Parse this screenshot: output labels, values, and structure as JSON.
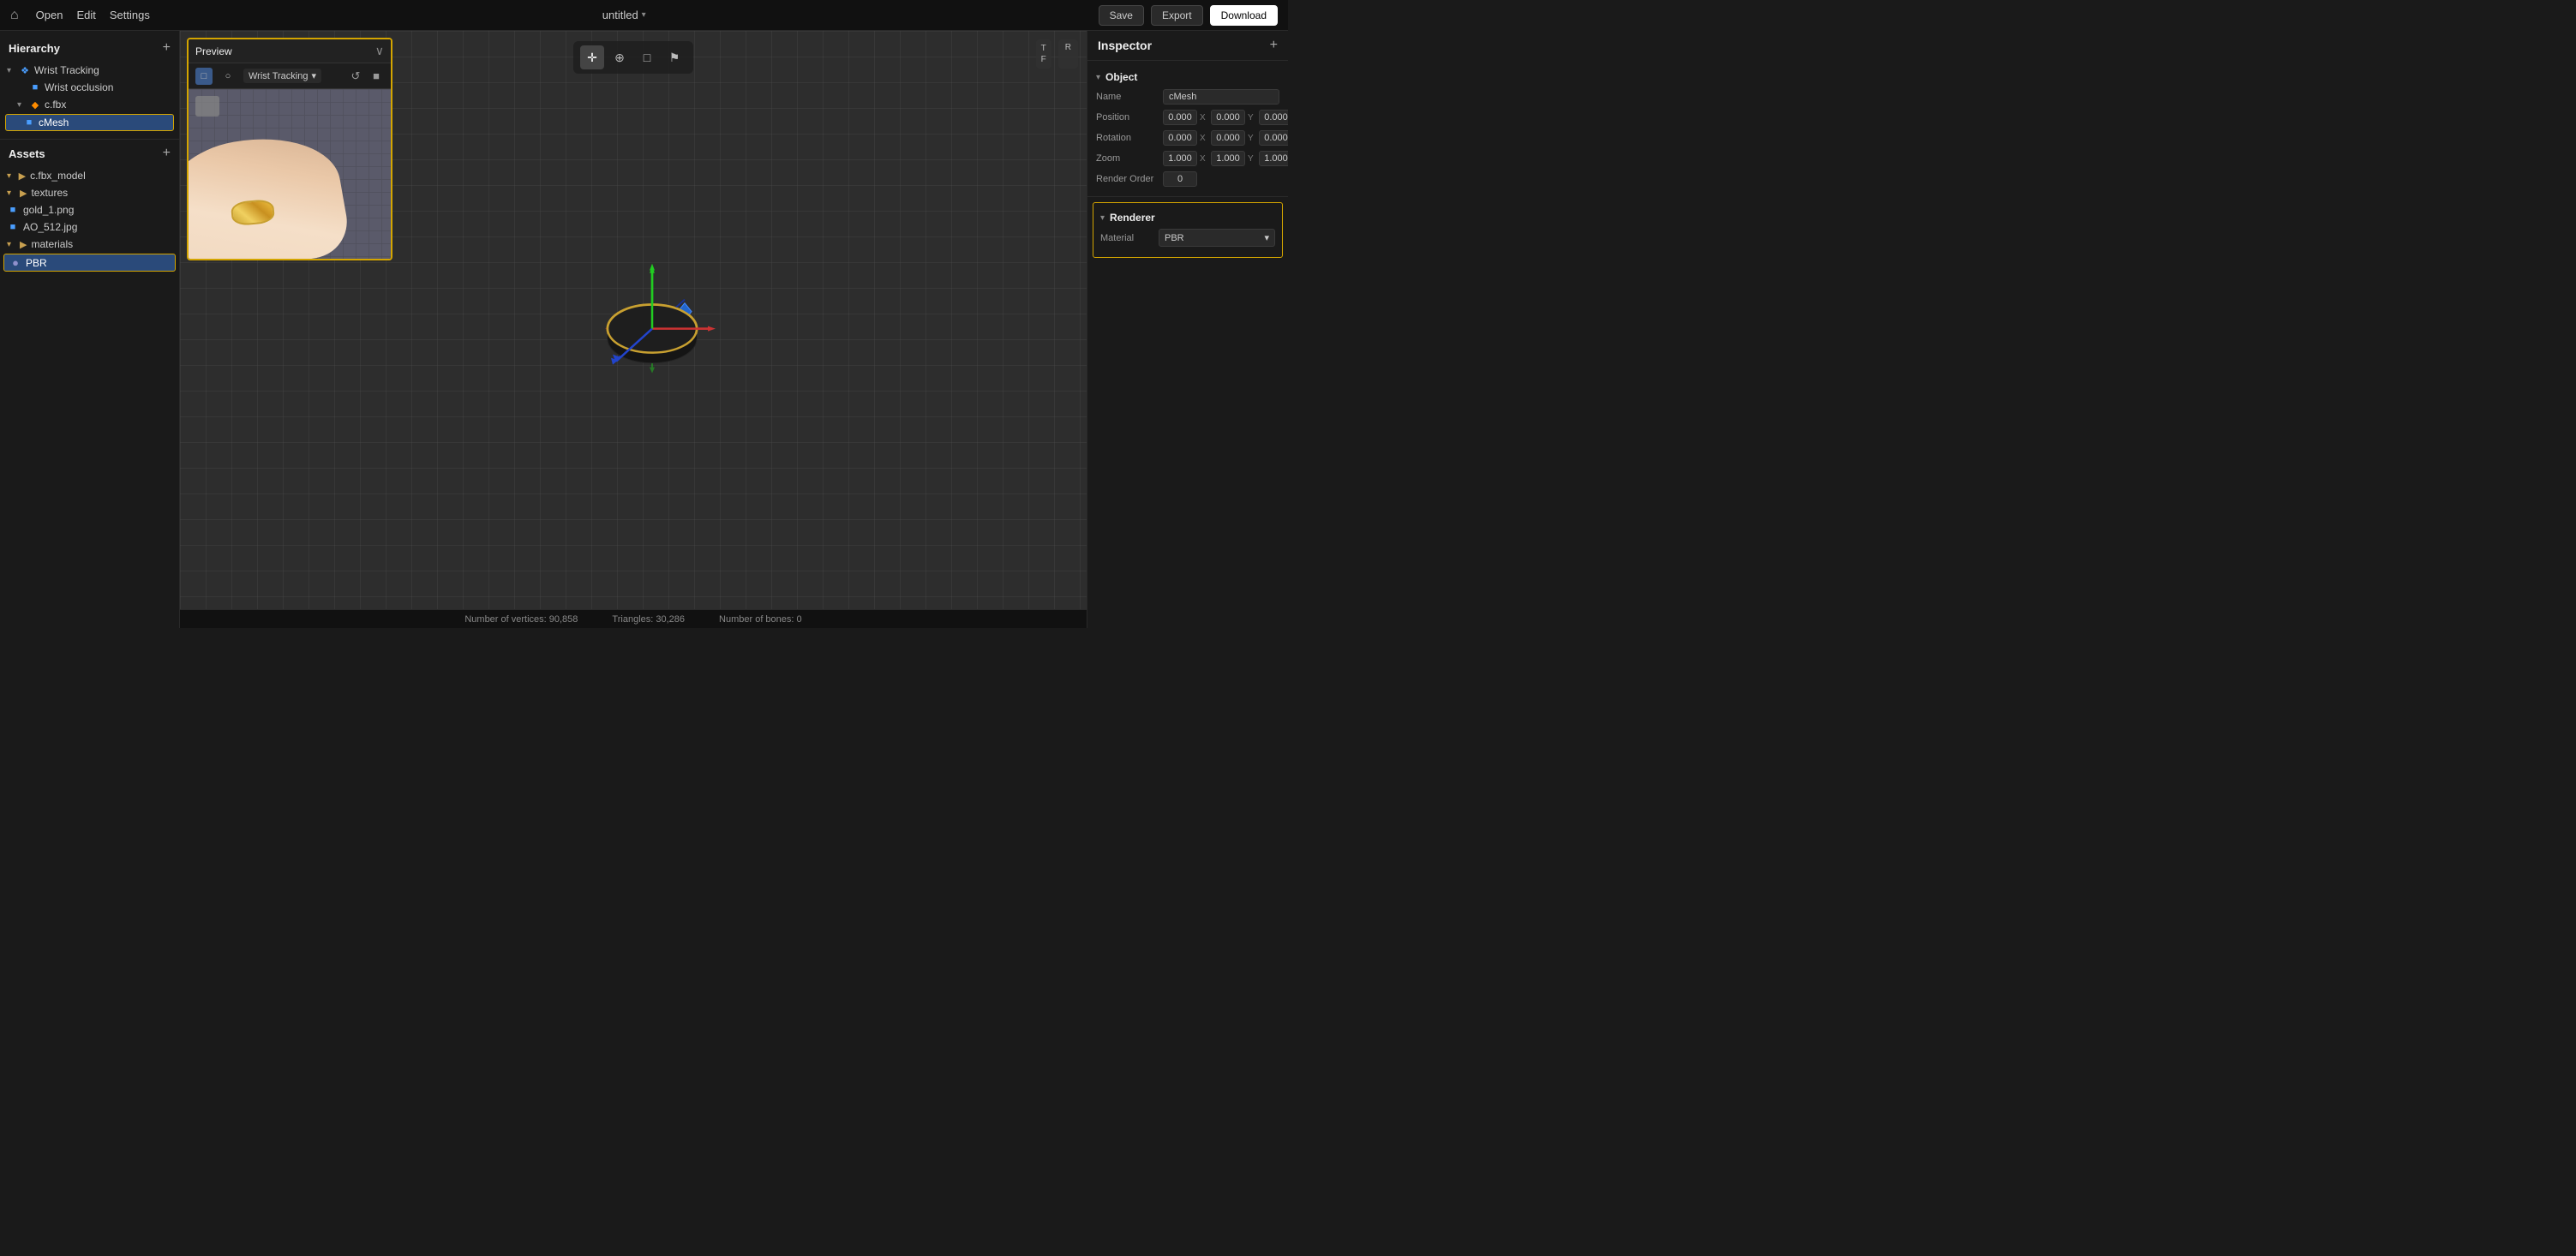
{
  "topbar": {
    "home_icon": "⌂",
    "menu": [
      "Open",
      "Edit",
      "Settings"
    ],
    "title": "untitled",
    "title_chevron": "▾",
    "save_label": "Save",
    "export_label": "Export",
    "download_label": "Download"
  },
  "hierarchy": {
    "title": "Hierarchy",
    "add_icon": "+",
    "items": [
      {
        "id": "wrist-tracking",
        "label": "Wrist Tracking",
        "indent": 0,
        "expand": "▾",
        "icon": "❖",
        "icon_class": "icon-blue"
      },
      {
        "id": "wrist-occlusion",
        "label": "Wrist occlusion",
        "indent": 1,
        "expand": "",
        "icon": "■",
        "icon_class": "icon-blue"
      },
      {
        "id": "cfbx",
        "label": "c.fbx",
        "indent": 1,
        "expand": "▾",
        "icon": "◆",
        "icon_class": "icon-orange"
      },
      {
        "id": "cmesh",
        "label": "cMesh",
        "indent": 2,
        "expand": "",
        "icon": "■",
        "icon_class": "icon-blue",
        "selected": true
      }
    ]
  },
  "assets": {
    "title": "Assets",
    "add_icon": "+",
    "items": [
      {
        "id": "cfbx-model",
        "label": "c.fbx_model",
        "indent": 0,
        "expand": "▾",
        "icon": "▶",
        "icon_class": "icon-folder",
        "is_input": true
      },
      {
        "id": "textures",
        "label": "textures",
        "indent": 0,
        "expand": "▾",
        "icon": "▶",
        "icon_class": "icon-folder"
      },
      {
        "id": "gold-png",
        "label": "gold_1.png",
        "indent": 1,
        "expand": "",
        "icon": "■",
        "icon_class": "icon-blue"
      },
      {
        "id": "ao-jpg",
        "label": "AO_512.jpg",
        "indent": 1,
        "expand": "",
        "icon": "■",
        "icon_class": "icon-blue"
      },
      {
        "id": "materials",
        "label": "materials",
        "indent": 0,
        "expand": "▾",
        "icon": "▶",
        "icon_class": "icon-folder"
      },
      {
        "id": "pbr",
        "label": "PBR",
        "indent": 1,
        "expand": "",
        "icon": "●",
        "icon_class": "icon-material",
        "selected": true
      }
    ]
  },
  "preview": {
    "title": "Preview",
    "close_icon": "∨",
    "dropdown_label": "Wrist Tracking",
    "dropdown_chevron": "▾",
    "btn_camera": "□",
    "btn_circle": "○",
    "btn_refresh": "↺",
    "btn_stop": "■"
  },
  "viewport": {
    "tools": [
      "✛",
      "⊕",
      "□",
      "⚑"
    ],
    "nav_icons": [
      "T\nF",
      "R"
    ]
  },
  "inspector": {
    "title": "Inspector",
    "add_icon": "+",
    "object_section": "Object",
    "name_label": "Name",
    "name_value": "cMesh",
    "position_label": "Position",
    "position_x": "0.000",
    "position_y": "0.000",
    "position_z": "0.000",
    "rotation_label": "Rotation",
    "rotation_x": "0.000",
    "rotation_y": "0.000",
    "rotation_z": "0.000",
    "zoom_label": "Zoom",
    "zoom_x": "1.000",
    "zoom_y": "1.000",
    "zoom_z": "1.000",
    "render_order_label": "Render Order",
    "render_order_value": "0",
    "renderer_section": "Renderer",
    "material_label": "Material",
    "material_value": "PBR"
  },
  "statusbar": {
    "vertices_label": "Number of vertices: 90,858",
    "triangles_label": "Triangles: 30,286",
    "bones_label": "Number of bones: 0"
  }
}
